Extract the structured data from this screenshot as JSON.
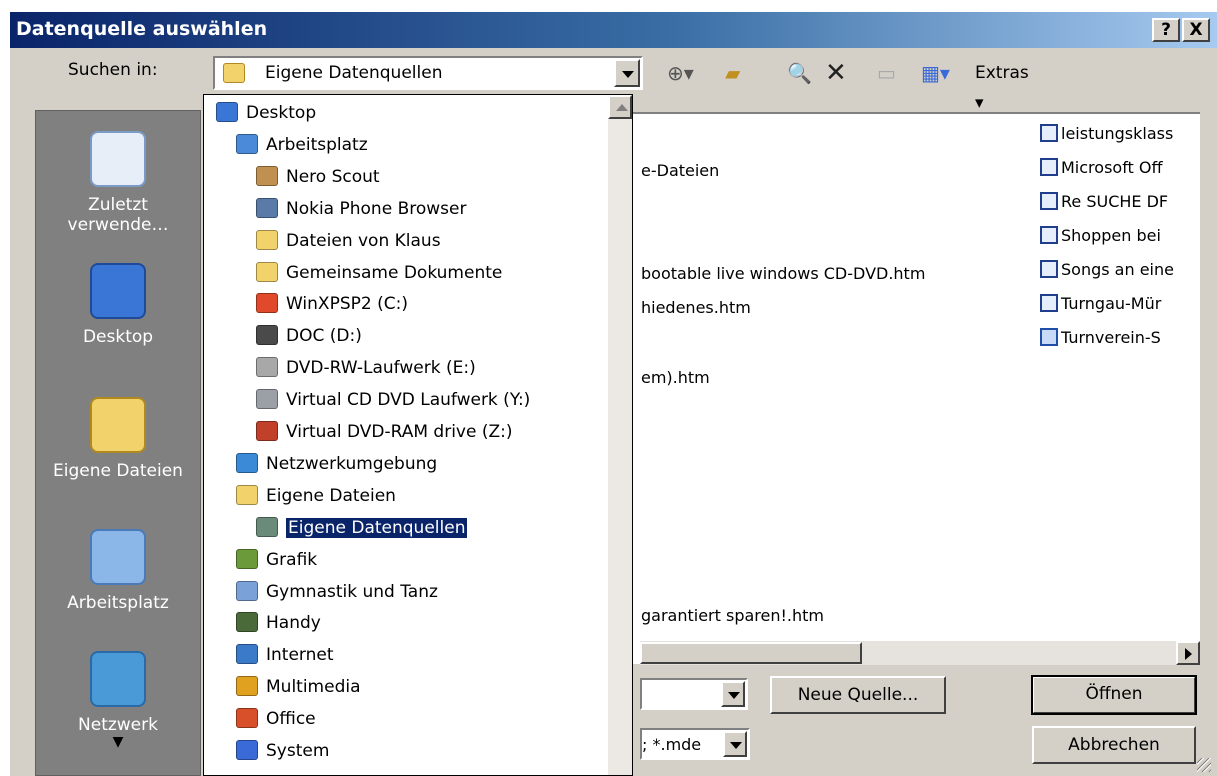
{
  "window": {
    "title": "Datenquelle auswählen",
    "help_btn": "?",
    "close_btn": "X"
  },
  "lookin": {
    "label": "Suchen in:",
    "value": "Eigene Datenquellen"
  },
  "toolbar": {
    "extras_label": "Extras"
  },
  "places": [
    "Zuletzt verwende…",
    "Desktop",
    "Eigene Dateien",
    "Arbeitsplatz",
    "Netzwerk"
  ],
  "files_visible": [
    "e-Dateien",
    "bootable live windows CD-DVD.htm",
    "hiedenes.htm",
    "em).htm",
    "garantiert sparen!.htm"
  ],
  "files_right": [
    "leistungsklass",
    "Microsoft Off",
    "Re SUCHE DF",
    "Shoppen bei",
    "Songs an eine",
    "Turngau-Mür",
    "Turnverein-S"
  ],
  "dropdown_items": [
    {
      "label": "Desktop",
      "level": 0,
      "icon": "desktop-icon",
      "color": "#3a76d6"
    },
    {
      "label": "Arbeitsplatz",
      "level": 1,
      "icon": "computer-icon",
      "color": "#4a8ad8"
    },
    {
      "label": "Nero Scout",
      "level": 2,
      "icon": "nero-scout-icon",
      "color": "#c09050"
    },
    {
      "label": "Nokia Phone Browser",
      "level": 2,
      "icon": "phone-browser-icon",
      "color": "#5a7aa8"
    },
    {
      "label": "Dateien von Klaus",
      "level": 2,
      "icon": "folder-icon",
      "color": "#f2d26b"
    },
    {
      "label": "Gemeinsame Dokumente",
      "level": 2,
      "icon": "folder-icon",
      "color": "#f2d26b"
    },
    {
      "label": "WinXPSP2 (C:)",
      "level": 2,
      "icon": "windows-drive-icon",
      "color": "#e04a2a"
    },
    {
      "label": "DOC (D:)",
      "level": 2,
      "icon": "drive-icon",
      "color": "#4a4a4a"
    },
    {
      "label": "DVD-RW-Laufwerk (E:)",
      "level": 2,
      "icon": "dvd-drive-icon",
      "color": "#a8a8a8"
    },
    {
      "label": "Virtual CD DVD Laufwerk (Y:)",
      "level": 2,
      "icon": "cd-drive-icon",
      "color": "#9aa0a6"
    },
    {
      "label": "Virtual DVD-RAM drive (Z:)",
      "level": 2,
      "icon": "dvd-ram-icon",
      "color": "#c0402a"
    },
    {
      "label": "Netzwerkumgebung",
      "level": 1,
      "icon": "network-icon",
      "color": "#3a8ad8"
    },
    {
      "label": "Eigene Dateien",
      "level": 1,
      "icon": "my-documents-icon",
      "color": "#f2d26b"
    },
    {
      "label": "Eigene Datenquellen",
      "level": 2,
      "icon": "datasource-folder-icon",
      "color": "#6a8a7a",
      "selected": true
    },
    {
      "label": "Grafik",
      "level": 1,
      "icon": "graphics-icon",
      "color": "#6a9a3a"
    },
    {
      "label": "Gymnastik und Tanz",
      "level": 1,
      "icon": "image-folder-icon",
      "color": "#7aa2d8"
    },
    {
      "label": "Handy",
      "level": 1,
      "icon": "handy-icon",
      "color": "#4a6a3a"
    },
    {
      "label": "Internet",
      "level": 1,
      "icon": "internet-icon",
      "color": "#3a7ac8"
    },
    {
      "label": "Multimedia",
      "level": 1,
      "icon": "multimedia-icon",
      "color": "#e0a020"
    },
    {
      "label": "Office",
      "level": 1,
      "icon": "office-icon",
      "color": "#d8502a"
    },
    {
      "label": "System",
      "level": 1,
      "icon": "system-icon",
      "color": "#3a6ad8"
    }
  ],
  "filename_field": {
    "value": ""
  },
  "filetype_field": {
    "value": "; *.mde"
  },
  "buttons": {
    "new_source": "Neue Quelle...",
    "open": "Öffnen",
    "cancel": "Abbrechen"
  }
}
